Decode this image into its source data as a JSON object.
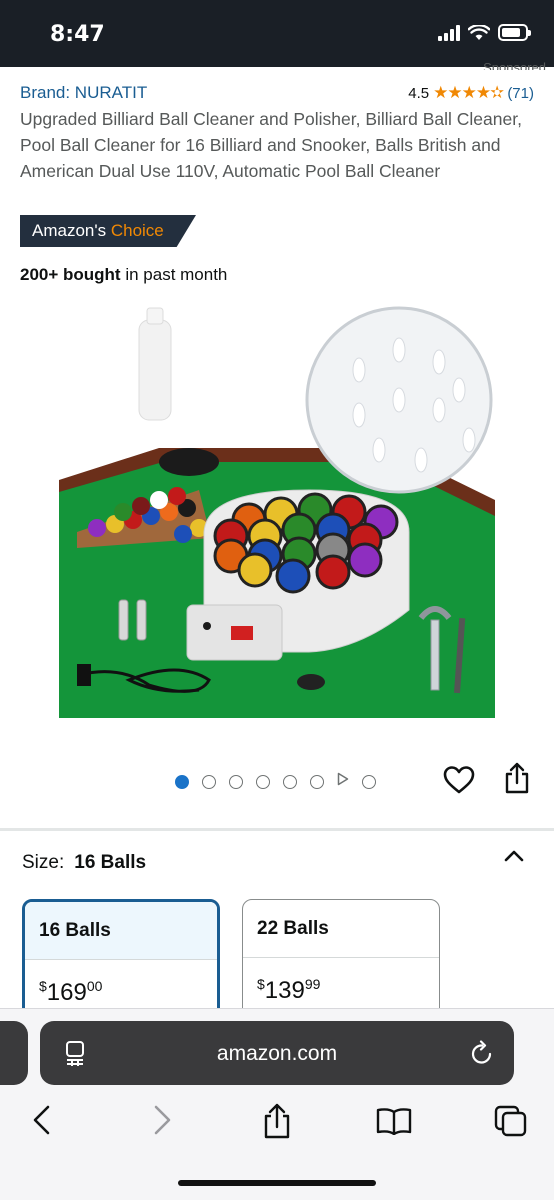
{
  "status_bar": {
    "time": "8:47",
    "battery_level": 0.8
  },
  "sponsored_label": "Sponsored",
  "product": {
    "brand_label": "Brand: NURATIT",
    "rating_value": "4.5",
    "rating_stars": "★★★★✫",
    "rating_count": "(71)",
    "title": "Upgraded Billiard Ball Cleaner and Polisher, Billiard Ball Cleaner, Pool Ball Cleaner for 16 Billiard and Snooker, Balls British and American Dual Use 110V, Automatic Pool Ball Cleaner",
    "badge_prefix": "Amazon's ",
    "badge_accent": "Choice",
    "bought_bold": "200+ bought",
    "bought_rest": " in past month",
    "image_alt": "Billiard ball cleaner product photo"
  },
  "carousel": {
    "image_count": 6,
    "has_video": true,
    "extra_dots": 1,
    "active_index": 0
  },
  "size": {
    "label": "Size:",
    "selected": "16 Balls",
    "options": [
      {
        "name": "16 Balls",
        "price_symbol": "$",
        "price_whole": "169",
        "price_fraction": "00"
      },
      {
        "name": "22 Balls",
        "price_symbol": "$",
        "price_whole": "139",
        "price_fraction": "99"
      }
    ]
  },
  "browser": {
    "url": "amazon.com"
  },
  "colors": {
    "link": "#1a5d92",
    "star": "#f08804",
    "badge_bg": "#232f3e",
    "active_dot": "#1a73c8"
  }
}
